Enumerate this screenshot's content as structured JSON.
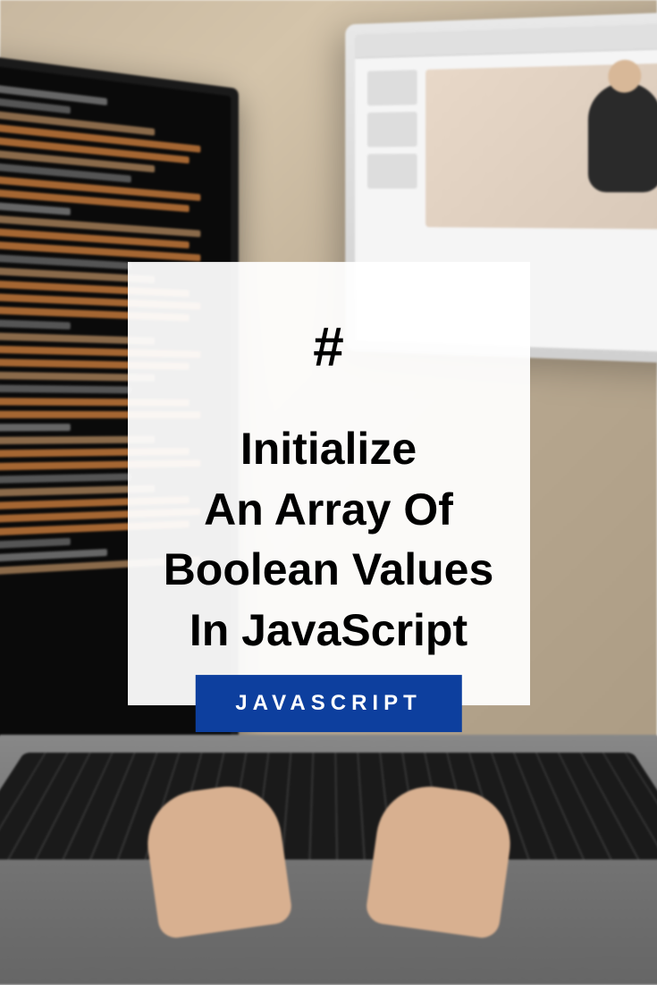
{
  "card": {
    "hash_symbol": "#",
    "title_line_1": "Initialize",
    "title_line_2": "An Array Of",
    "title_line_3": "Boolean Values",
    "title_line_4": "In JavaScript"
  },
  "badge": {
    "label": "JAVASCRIPT"
  },
  "colors": {
    "badge_bg": "#0d3f9e",
    "card_bg": "rgba(255,255,255,0.94)"
  }
}
